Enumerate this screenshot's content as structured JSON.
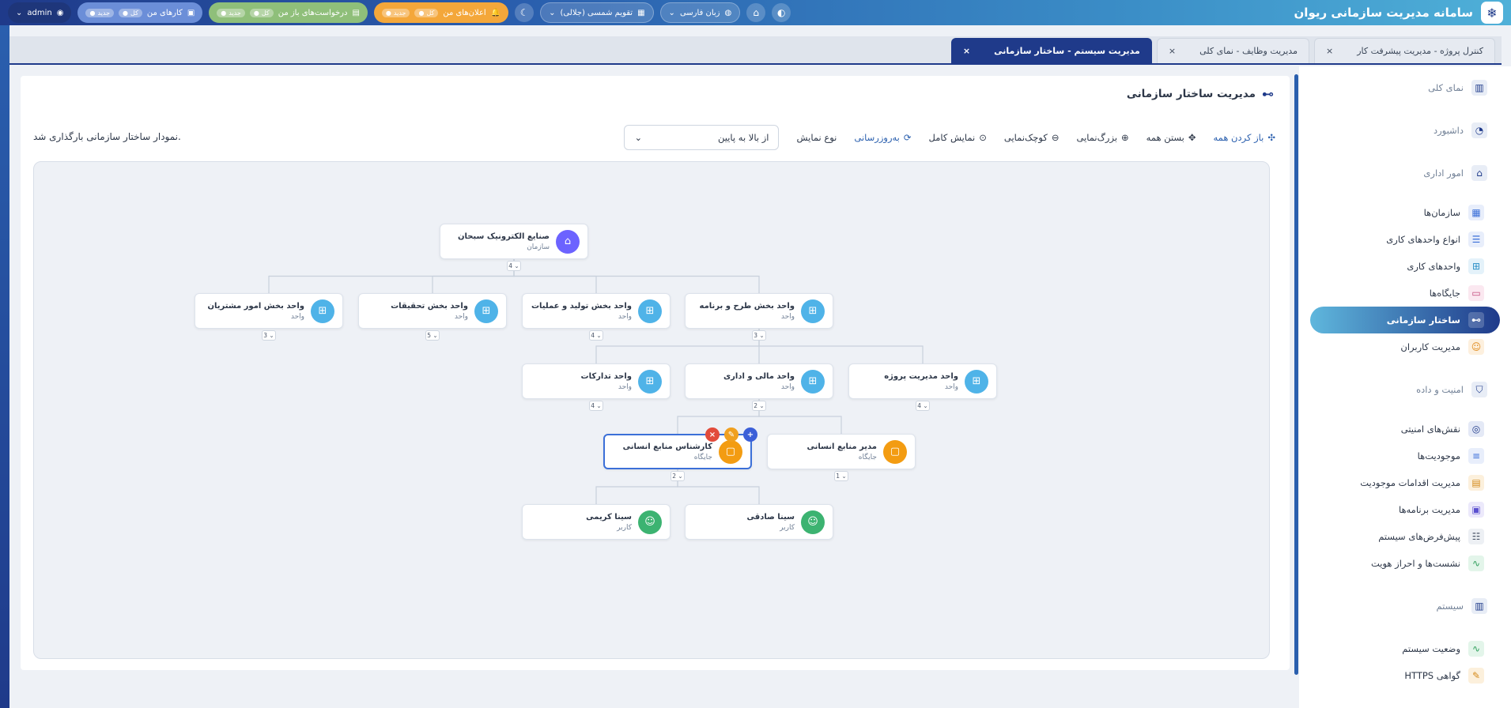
{
  "header": {
    "title": "سامانه مدیریت سازمانی ریوان",
    "user": "admin",
    "language": "زبان فارسی",
    "calendar": "تقویم شمسی (جلالی)",
    "badges": [
      {
        "label": "اعلان‌های من",
        "all": "کل",
        "new": "جدید"
      },
      {
        "label": "درخواست‌های باز من",
        "all": "کل",
        "new": "جدید"
      },
      {
        "label": "کارهای من",
        "all": "کل",
        "new": "جدید"
      }
    ],
    "colors": {
      "badge1": "#f4a73a",
      "badge2": "#8fbf7a",
      "badge3": "#6b8ed8"
    }
  },
  "tabs": [
    {
      "label": "کنترل پروژه  -  مدیریت پیشرفت کار",
      "active": false
    },
    {
      "label": "مدیریت وظایف  -  نمای کلی",
      "active": false
    },
    {
      "label": "مدیریت سیستم  -  ساختار سازمانی",
      "active": true
    }
  ],
  "sidebar": {
    "items": [
      {
        "label": "نمای کلی",
        "section": true
      },
      {
        "label": "داشبورد",
        "section": true
      },
      {
        "label": "امور اداری",
        "section": true
      },
      {
        "label": "سازمان‌ها"
      },
      {
        "label": "انواع واحدهای کاری"
      },
      {
        "label": "واحدهای کاری"
      },
      {
        "label": "جایگاه‌ها"
      },
      {
        "label": "ساختار سازمانی",
        "active": true
      },
      {
        "label": "مدیریت کاربران"
      },
      {
        "label": "امنیت و داده",
        "section": true
      },
      {
        "label": "نقش‌های امنیتی"
      },
      {
        "label": "موجودیت‌ها"
      },
      {
        "label": "مدیریت اقدامات موجودیت"
      },
      {
        "label": "مدیریت برنامه‌ها"
      },
      {
        "label": "پیش‌فرض‌های سیستم"
      },
      {
        "label": "نشست‌ها و احراز هویت"
      },
      {
        "label": "سیستم",
        "section": true
      },
      {
        "label": "وضعیت سیستم"
      },
      {
        "label": "گواهی HTTPS"
      }
    ]
  },
  "main": {
    "title": "مدیریت ساختار سازمانی",
    "toolbar": {
      "expand_all": "باز کردن همه",
      "collapse_all": "بستن همه",
      "zoom_in": "بزرگ‌نمایی",
      "zoom_out": "کوچک‌نمایی",
      "full_view": "نمایش کامل",
      "refresh": "به‌روزرسانی",
      "view_type_label": "نوع نمایش",
      "view_type_value": "از بالا به پایین"
    },
    "status": "نمودار ساختار سازمانی بارگذاری شد."
  },
  "tree": {
    "colors": {
      "org": "#6c63ff",
      "unit": "#4fb3e8",
      "position": "#f39c12",
      "user": "#3cb371"
    },
    "nodes": [
      {
        "id": "org",
        "name": "صنایع الکترونیک سبحان",
        "type": "سازمان",
        "kind": "org",
        "count": "4"
      },
      {
        "id": "u1",
        "name": "واحد بخش طرح و برنامه",
        "type": "واحد",
        "kind": "unit",
        "count": "3"
      },
      {
        "id": "u2",
        "name": "واحد بخش تولید و عملیات",
        "type": "واحد",
        "kind": "unit",
        "count": "4"
      },
      {
        "id": "u3",
        "name": "واحد بخش تحقیقات",
        "type": "واحد",
        "kind": "unit",
        "count": "5"
      },
      {
        "id": "u4",
        "name": "واحد بخش امور مشتریان",
        "type": "واحد",
        "kind": "unit",
        "count": "3"
      },
      {
        "id": "u5",
        "name": "واحد مدیریت پروژه",
        "type": "واحد",
        "kind": "unit",
        "count": "4"
      },
      {
        "id": "u6",
        "name": "واحد مالی و اداری",
        "type": "واحد",
        "kind": "unit",
        "count": "2"
      },
      {
        "id": "u7",
        "name": "واحد تدارکات",
        "type": "واحد",
        "kind": "unit",
        "count": "4"
      },
      {
        "id": "p1",
        "name": "مدیر منابع انسانی",
        "type": "جایگاه",
        "kind": "position",
        "count": "1"
      },
      {
        "id": "p2",
        "name": "کارشناس منابع انسانی",
        "type": "جایگاه",
        "kind": "position",
        "count": "2",
        "selected": true
      },
      {
        "id": "e1",
        "name": "سینا صادقی",
        "type": "کاربر",
        "kind": "user"
      },
      {
        "id": "e2",
        "name": "سینا کریمی",
        "type": "کاربر",
        "kind": "user"
      }
    ]
  }
}
